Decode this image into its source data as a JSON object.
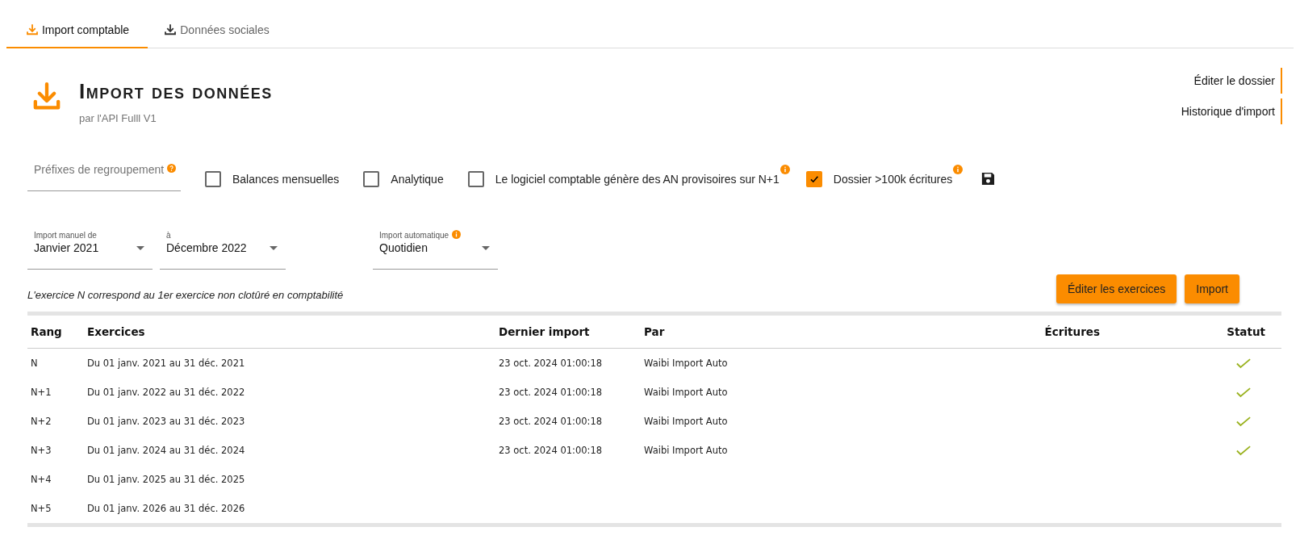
{
  "tabs": [
    {
      "label": "Import comptable",
      "selected": true
    },
    {
      "label": "Données sociales",
      "selected": false
    }
  ],
  "header": {
    "title": "Import des données",
    "subtitle": "par l'API Fulll V1"
  },
  "links": [
    "Éditer le dossier",
    "Historique d'import"
  ],
  "prefix_field": {
    "placeholder": "Préfixes de regroupement"
  },
  "options": [
    {
      "label": "Balances mensuelles",
      "checked": false,
      "info": false
    },
    {
      "label": "Analytique",
      "checked": false,
      "info": false
    },
    {
      "label": "Le logiciel comptable génère des AN provisoires sur N+1",
      "checked": false,
      "info": true
    },
    {
      "label": "Dossier >100k écritures",
      "checked": true,
      "info": true
    }
  ],
  "selects": [
    {
      "label": "Import manuel de",
      "value": "Janvier 2021",
      "info": false
    },
    {
      "label": "à",
      "value": "Décembre 2022",
      "info": false
    },
    {
      "label": "Import automatique",
      "value": "Quotidien",
      "info": true
    }
  ],
  "note": "L'exercice N correspond au 1er exercice non clotûré en comptabilité",
  "buttons": [
    "Éditer les exercices",
    "Import"
  ],
  "table": {
    "columns": [
      "Rang",
      "Exercices",
      "Dernier import",
      "Par",
      "Écritures",
      "Statut"
    ],
    "rows": [
      {
        "rang": "N",
        "exercice": "Du 01 janv. 2021 au 31 déc. 2021",
        "last_import": "23 oct. 2024 01:00:18",
        "by": "Waibi Import Auto",
        "imported": true
      },
      {
        "rang": "N+1",
        "exercice": "Du 01 janv. 2022 au 31 déc. 2022",
        "last_import": "23 oct. 2024 01:00:18",
        "by": "Waibi Import Auto",
        "imported": true
      },
      {
        "rang": "N+2",
        "exercice": "Du 01 janv. 2023 au 31 déc. 2023",
        "last_import": "23 oct. 2024 01:00:18",
        "by": "Waibi Import Auto",
        "imported": true
      },
      {
        "rang": "N+3",
        "exercice": "Du 01 janv. 2024 au 31 déc. 2024",
        "last_import": "23 oct. 2024 01:00:18",
        "by": "Waibi Import Auto",
        "imported": true
      },
      {
        "rang": "N+4",
        "exercice": "Du 01 janv. 2025 au 31 déc. 2025",
        "imported": false
      },
      {
        "rang": "N+5",
        "exercice": "Du 01 janv. 2026 au 31 déc. 2026",
        "imported": false
      }
    ]
  }
}
